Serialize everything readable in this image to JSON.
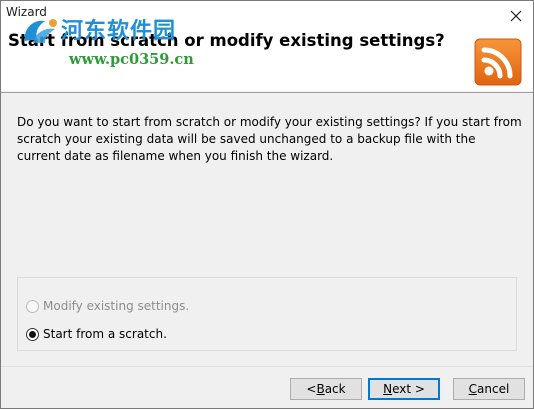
{
  "window": {
    "title": "Wizard"
  },
  "header": {
    "title": "Start from scratch or modify existing settings?"
  },
  "watermark": {
    "site_name_cn": "河东软件园",
    "url": "www.pc0359.cn"
  },
  "description": "Do you want to start from scratch or modify your existing settings? If you start from scratch your existing data will be saved unchanged to a backup file with the current date as filename when you finish the wizard.",
  "options": {
    "modify_label": "Modify existing settings.",
    "modify_enabled": false,
    "modify_selected": false,
    "scratch_label": "Start from a scratch.",
    "scratch_enabled": true,
    "scratch_selected": true
  },
  "buttons": {
    "back": {
      "mnemonic": "B",
      "rest": "ack",
      "prefix": "< "
    },
    "next": {
      "mnemonic": "N",
      "rest": "ext >"
    },
    "cancel": {
      "mnemonic": "C",
      "rest": "ancel"
    }
  },
  "colors": {
    "app_icon": "#ee7318",
    "watermark_cn": "#1f8fd6",
    "watermark_url": "#2e9a3a",
    "default_button_border": "#0078d7"
  },
  "icons": {
    "close": "close-icon",
    "app": "rss-feed-icon",
    "watermark_logo": "watermark-logo-icon"
  }
}
